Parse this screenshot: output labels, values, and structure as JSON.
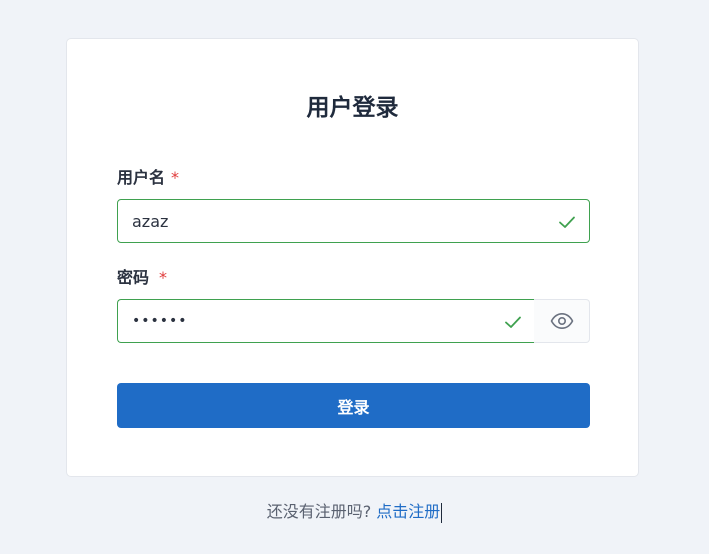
{
  "form": {
    "title": "用户登录",
    "username": {
      "label": "用户名",
      "required_mark": "*",
      "value": "azaz",
      "status": "valid",
      "status_icon": "check-icon"
    },
    "password": {
      "label": "密码",
      "required_mark": "*",
      "value": "azazaz",
      "masked": true,
      "status": "valid",
      "status_icon": "check-icon",
      "toggle_icon": "eye-icon"
    },
    "submit_label": "登录"
  },
  "footer": {
    "prompt": "还没有注册吗?",
    "link_label": "点击注册"
  },
  "colors": {
    "page_background": "#f0f3f8",
    "card_background": "#ffffff",
    "primary": "#1f6cc6",
    "valid": "#3fa14f",
    "required": "#e03b3b",
    "text": "#2b3240"
  }
}
